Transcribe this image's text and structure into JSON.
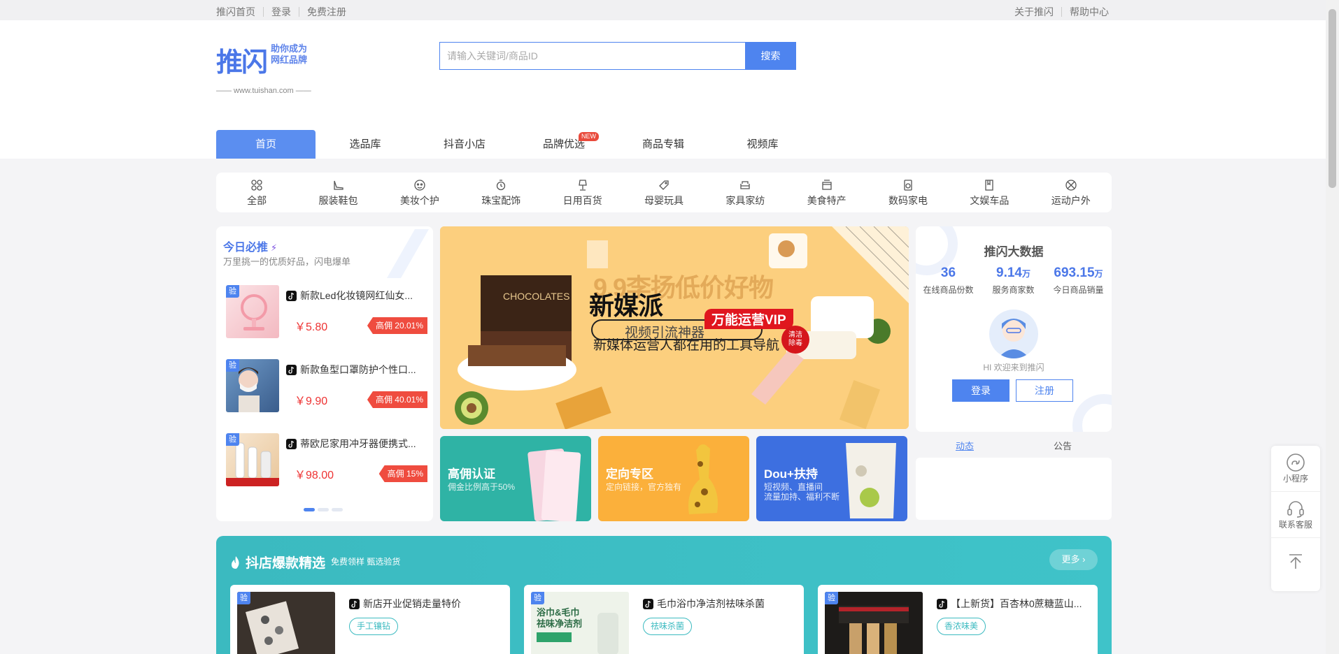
{
  "topbar": {
    "left": [
      "推闪首页",
      "登录",
      "免费注册"
    ],
    "right": [
      "关于推闪",
      "帮助中心"
    ]
  },
  "logo": {
    "name": "推闪",
    "slogan_line1": "助你成为",
    "slogan_line2": "网红品牌",
    "url": "—— www.tuishan.com ——"
  },
  "search": {
    "placeholder": "请输入关键词/商品ID",
    "button": "搜索"
  },
  "nav": {
    "items": [
      "首页",
      "选品库",
      "抖音小店",
      "品牌优选",
      "商品专辑",
      "视频库"
    ],
    "badge": "NEW"
  },
  "categories": [
    "全部",
    "服装鞋包",
    "美妆个护",
    "珠宝配饰",
    "日用百货",
    "母婴玩具",
    "家具家纺",
    "美食特产",
    "数码家电",
    "文娱车品",
    "运动户外"
  ],
  "today": {
    "title": "今日必推",
    "subtitle": "万里挑一的优质好品，闪电爆单",
    "badge": "验",
    "products": [
      {
        "name": "新款Led化妆镜网红仙女...",
        "price": "￥5.80",
        "commission": "高佣 20.01%"
      },
      {
        "name": "新款鱼型口罩防护个性口...",
        "price": "￥9.90",
        "commission": "高佣 40.01%"
      },
      {
        "name": "蒂欧尼家用冲牙器便携式...",
        "price": "￥98.00",
        "commission": "高佣 15%"
      }
    ]
  },
  "banner": {
    "headline": "新媒派",
    "ghost": "9.9李扬低价好物",
    "vip": "万能运营VIP",
    "circle": "视频引流神器",
    "subline": "新媒体运营人都在用的工具导航",
    "stamp": "清洁\n除毒"
  },
  "promos": [
    {
      "title": "高佣认证",
      "sub": "佣金比例高于50%",
      "color": "#2fb3a5"
    },
    {
      "title": "定向专区",
      "sub": "定向链接，官方独有",
      "color": "#fbb03b"
    },
    {
      "title": "Dou+扶持",
      "sub": "短视频、直播间\n流量加持、福利不断",
      "color": "#3d6fe0"
    }
  ],
  "bigdata": {
    "title": "推闪大数据",
    "stats": [
      {
        "value": "36",
        "unit": "",
        "label": "在线商品份数"
      },
      {
        "value": "9.14",
        "unit": "万",
        "label": "服务商家数"
      },
      {
        "value": "693.15",
        "unit": "万",
        "label": "今日商品销量"
      }
    ],
    "welcome": "HI 欢迎来到推闪",
    "login": "登录",
    "register": "注册"
  },
  "news_tabs": [
    "动态",
    "公告"
  ],
  "hot": {
    "title": "抖店爆款精选",
    "sub": "免费领样 甄选验货",
    "more": "更多",
    "badge": "验",
    "cards": [
      {
        "name": "新店开业促销走量特价",
        "tag": "手工镶钻"
      },
      {
        "name": "毛巾浴巾净洁剂祛味杀菌",
        "tag": "祛味杀菌"
      },
      {
        "name": "【上新货】百杏林0蔗糖蓝山...",
        "tag": "香浓味美"
      }
    ],
    "card2_img_text": "浴巾&毛巾\n祛味净洁剂"
  },
  "float": [
    "小程序",
    "联系客服"
  ]
}
